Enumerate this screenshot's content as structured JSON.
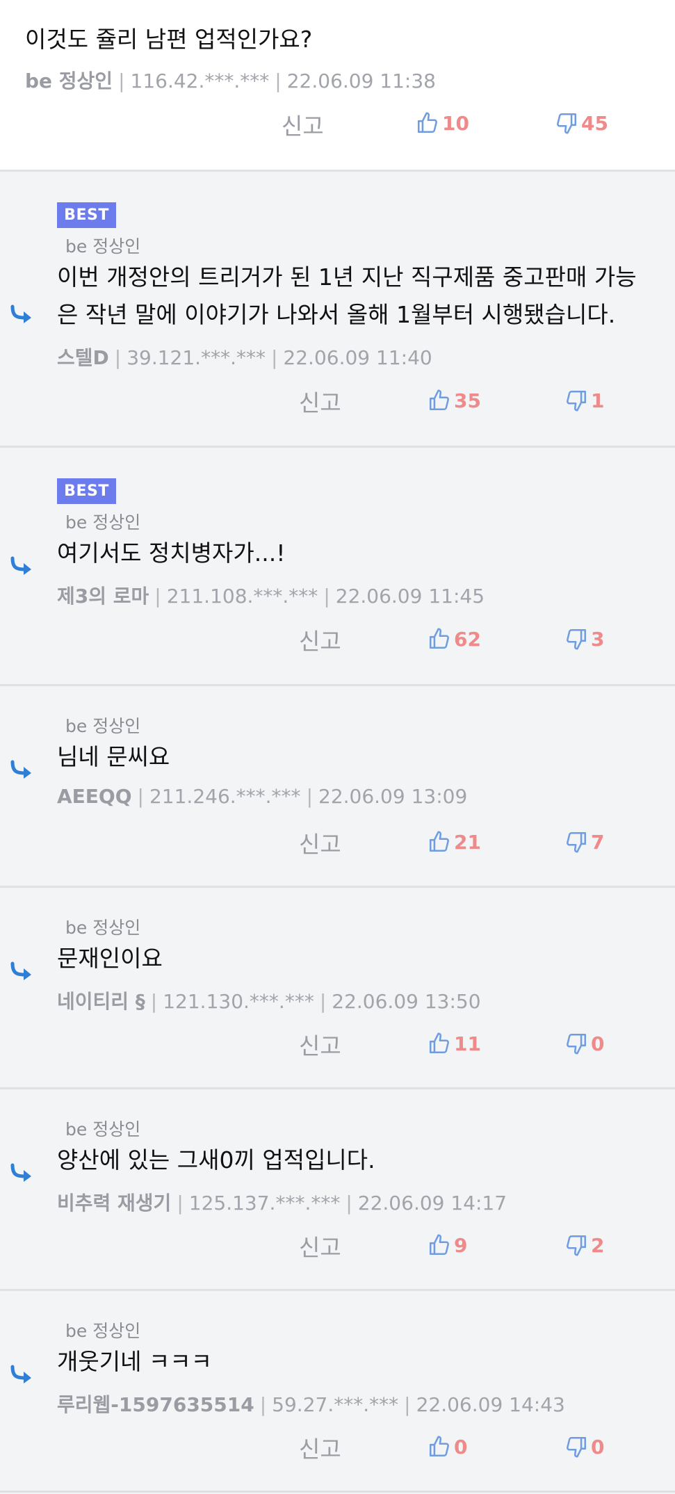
{
  "parent": {
    "text": "이것도 쥴리 남편 업적인가요?",
    "author": "be 정상인",
    "ip": "116.42.***.***",
    "date": "22.06.09 11:38",
    "report_label": "신고",
    "likes": "10",
    "dislikes": "45"
  },
  "replies": [
    {
      "best": "BEST",
      "to": "be 정상인",
      "text_lines": [
        "이번 개정안의 트리거가 된 1년 지난 직구제품 중고판매 가능",
        "은 작년 말에 이야기가 나와서 올해 1월부터 시행됐습니다."
      ],
      "author": "스텔D",
      "ip": "39.121.***.***",
      "date": "22.06.09 11:40",
      "report_label": "신고",
      "likes": "35",
      "dislikes": "1"
    },
    {
      "best": "BEST",
      "to": "be 정상인",
      "text_lines": [
        "여기서도 정치병자가...!"
      ],
      "author": "제3의 로마",
      "ip": "211.108.***.***",
      "date": "22.06.09 11:45",
      "report_label": "신고",
      "likes": "62",
      "dislikes": "3"
    },
    {
      "to": "be 정상인",
      "text_lines": [
        "님네 문씨요"
      ],
      "author": "AEEQQ",
      "ip": "211.246.***.***",
      "date": "22.06.09 13:09",
      "report_label": "신고",
      "likes": "21",
      "dislikes": "7"
    },
    {
      "to": "be 정상인",
      "text_lines": [
        "문재인이요"
      ],
      "author": "네이티리 §",
      "ip": "121.130.***.***",
      "date": "22.06.09 13:50",
      "report_label": "신고",
      "likes": "11",
      "dislikes": "0"
    },
    {
      "to": "be 정상인",
      "text_lines": [
        "양산에 있는 그새0끼 업적입니다."
      ],
      "author": "비추력 재생기",
      "ip": "125.137.***.***",
      "date": "22.06.09 14:17",
      "report_label": "신고",
      "likes": "9",
      "dislikes": "2"
    },
    {
      "to": "be 정상인",
      "text_lines": [
        "개웃기네 ㅋㅋㅋ"
      ],
      "author": "루리웹-1597635514",
      "ip": "59.27.***.***",
      "date": "22.06.09 14:43",
      "report_label": "신고",
      "likes": "0",
      "dislikes": "0"
    }
  ],
  "colors": {
    "like": "#6f9de0",
    "dislike": "#ef8a8a",
    "best_badge": "#6d7cec",
    "reply_arrow": "#2f7fd6"
  }
}
